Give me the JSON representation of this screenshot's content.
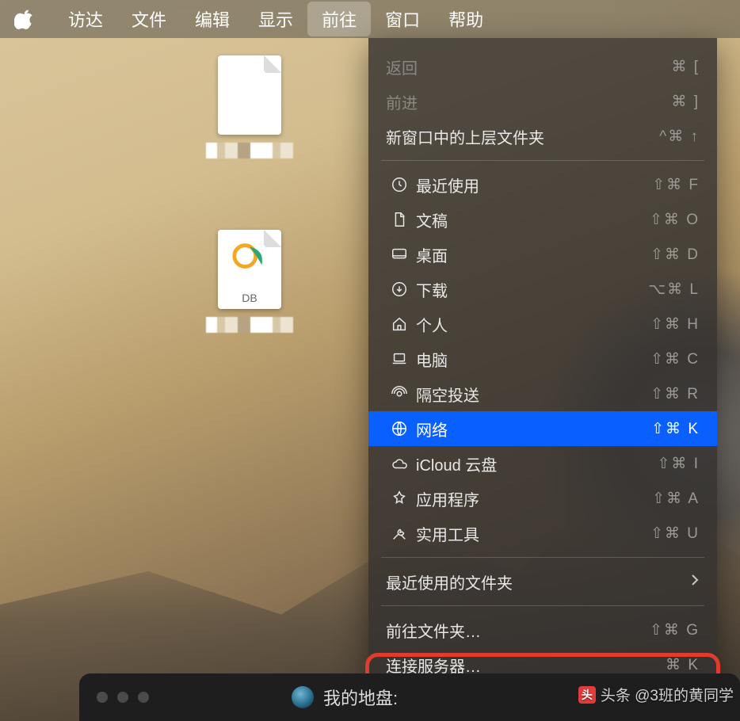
{
  "menubar": {
    "items": [
      {
        "label": "访达"
      },
      {
        "label": "文件"
      },
      {
        "label": "编辑"
      },
      {
        "label": "显示"
      },
      {
        "label": "前往",
        "active": true
      },
      {
        "label": "窗口"
      },
      {
        "label": "帮助"
      }
    ]
  },
  "desktop_files": {
    "db_label": "DB"
  },
  "menu": {
    "nav": {
      "back": {
        "label": "返回",
        "shortcut": "⌘ ["
      },
      "forward": {
        "label": "前进",
        "shortcut": "⌘ ]"
      },
      "enclosing": {
        "label": "新窗口中的上层文件夹",
        "shortcut": "^⌘ ↑"
      }
    },
    "places": [
      {
        "key": "recent",
        "label": "最近使用",
        "shortcut": "⇧⌘ F",
        "icon": "clock"
      },
      {
        "key": "documents",
        "label": "文稿",
        "shortcut": "⇧⌘ O",
        "icon": "doc"
      },
      {
        "key": "desktop",
        "label": "桌面",
        "shortcut": "⇧⌘ D",
        "icon": "desktop"
      },
      {
        "key": "downloads",
        "label": "下载",
        "shortcut": "⌥⌘ L",
        "icon": "download"
      },
      {
        "key": "home",
        "label": "个人",
        "shortcut": "⇧⌘ H",
        "icon": "home"
      },
      {
        "key": "computer",
        "label": "电脑",
        "shortcut": "⇧⌘ C",
        "icon": "laptop"
      },
      {
        "key": "airdrop",
        "label": "隔空投送",
        "shortcut": "⇧⌘ R",
        "icon": "airdrop"
      },
      {
        "key": "network",
        "label": "网络",
        "shortcut": "⇧⌘ K",
        "icon": "globe",
        "selected": true
      },
      {
        "key": "icloud",
        "label": "iCloud 云盘",
        "shortcut": "⇧⌘ I",
        "icon": "cloud"
      },
      {
        "key": "apps",
        "label": "应用程序",
        "shortcut": "⇧⌘ A",
        "icon": "apps"
      },
      {
        "key": "utilities",
        "label": "实用工具",
        "shortcut": "⇧⌘ U",
        "icon": "tools"
      }
    ],
    "recent_folders": {
      "label": "最近使用的文件夹"
    },
    "goto_folder": {
      "label": "前往文件夹…",
      "shortcut": "⇧⌘ G"
    },
    "connect_server": {
      "label": "连接服务器…",
      "shortcut": "⌘ K"
    }
  },
  "minibar": {
    "title": "我的地盘:"
  },
  "watermark": {
    "text": "头条 @3班的黄同学"
  }
}
